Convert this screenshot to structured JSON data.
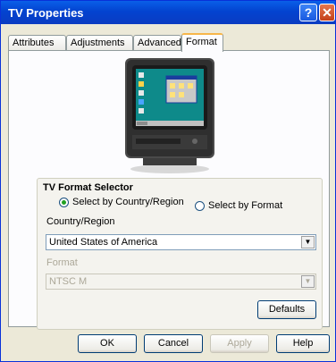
{
  "window": {
    "title": "TV Properties",
    "help_glyph": "?",
    "close_glyph": "✕"
  },
  "tabs": [
    {
      "label": "Attributes"
    },
    {
      "label": "Adjustments"
    },
    {
      "label": "Advanced"
    },
    {
      "label": "Format"
    }
  ],
  "format_selector": {
    "title": "TV Format Selector",
    "radio_country": "Select by Country/Region",
    "radio_format": "Select by Format",
    "selected_radio": "country",
    "country_label": "Country/Region",
    "country_value": "United States of America",
    "format_label": "Format",
    "format_value": "NTSC M",
    "defaults_label": "Defaults"
  },
  "footer": {
    "ok_label": "OK",
    "cancel_label": "Cancel",
    "apply_label": "Apply",
    "help_label": "Help"
  },
  "dropdown_arrow": "▼",
  "colors": {
    "titlebar": "#0a3cc2",
    "active_tab_accent": "#f7b64a",
    "dialog_bg": "#ece9d8"
  }
}
